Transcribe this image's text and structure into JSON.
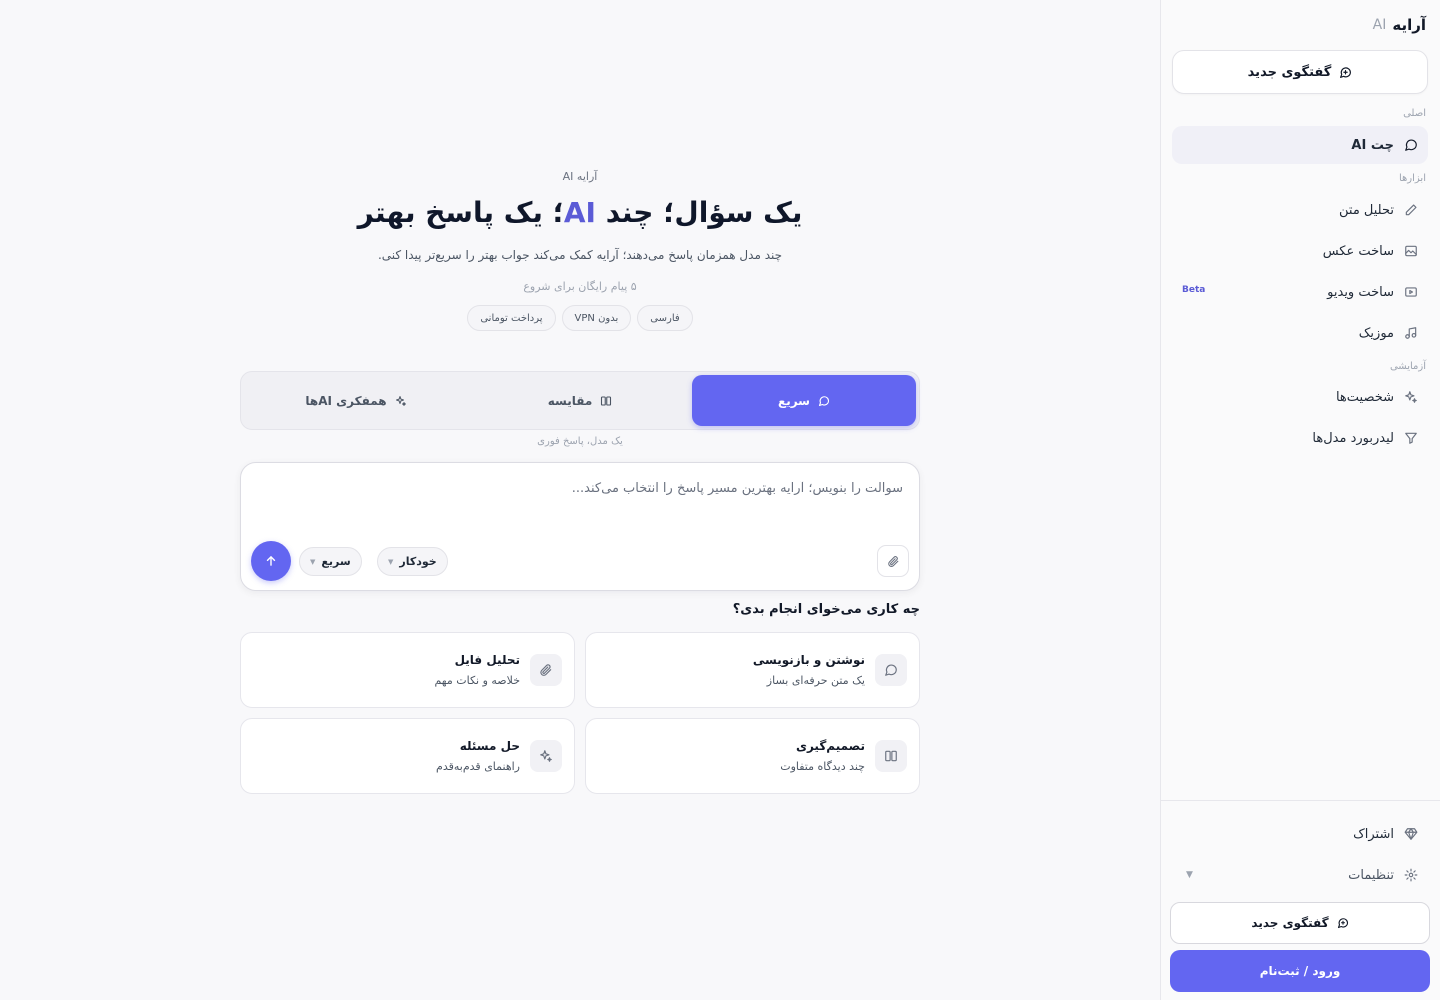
{
  "sidebar": {
    "brand_name": "آرایه",
    "brand_suffix": "AI",
    "new_chat": "گفتگوی جدید",
    "section_main": "اصلی",
    "item_chat": "چت AI",
    "section_tools": "ابزارها",
    "item_text_analysis": "تحلیل متن",
    "item_image": "ساخت عکس",
    "item_video": "ساخت ویدیو",
    "video_badge": "Beta",
    "item_music": "موزیک",
    "section_experimental": "آزمایشی",
    "item_personas": "شخصیت‌ها",
    "item_leaderboard": "لیدربورد مدل‌ها",
    "item_subscription": "اشتراک",
    "item_settings": "تنظیمات",
    "new_chat_bottom": "گفتگوی جدید",
    "login": "ورود / ثبت‌نام"
  },
  "hero": {
    "kicker": "آرایه AI",
    "headline_part1": "یک سؤال؛ چند ",
    "headline_accent": "AI",
    "headline_part2": "؛ یک پاسخ بهتر",
    "subline": "چند مدل همزمان پاسخ می‌دهند؛ آرایه کمک می‌کند جواب بهتر را سریع‌تر پیدا کنی.",
    "free_note": "۵ پیام رایگان برای شروع",
    "chips": [
      "فارسی",
      "بدون VPN",
      "پرداخت تومانی"
    ]
  },
  "modes": {
    "fast": "سریع",
    "compare": "مقایسه",
    "collab": "همفکری AIها",
    "hint": "یک مدل، پاسخ فوری"
  },
  "composer": {
    "placeholder": "سوالت را بنویس؛ آرایه بهترین مسیر پاسخ را انتخاب می‌کند...",
    "value": "",
    "model_select": "خودکار",
    "speed_select": "سریع"
  },
  "suggestions": {
    "title": "چه کاری می‌خوای انجام بدی؟",
    "cards": [
      {
        "title": "نوشتن و بازنویسی",
        "subtitle": "یک متن حرفه‌ای بساز",
        "icon": "chat-bubble-icon"
      },
      {
        "title": "تحلیل فایل",
        "subtitle": "خلاصه و نکات مهم",
        "icon": "paperclip-icon"
      },
      {
        "title": "تصمیم‌گیری",
        "subtitle": "چند دیدگاه متفاوت",
        "icon": "columns-icon"
      },
      {
        "title": "حل مسئله",
        "subtitle": "راهنمای قدم‌به‌قدم",
        "icon": "sparkle-icon"
      }
    ]
  },
  "colors": {
    "accent": "#6366f1",
    "accent_text": "#5b5bd6",
    "background": "#f8f8fa",
    "sidebar_bg": "#fafafb"
  }
}
